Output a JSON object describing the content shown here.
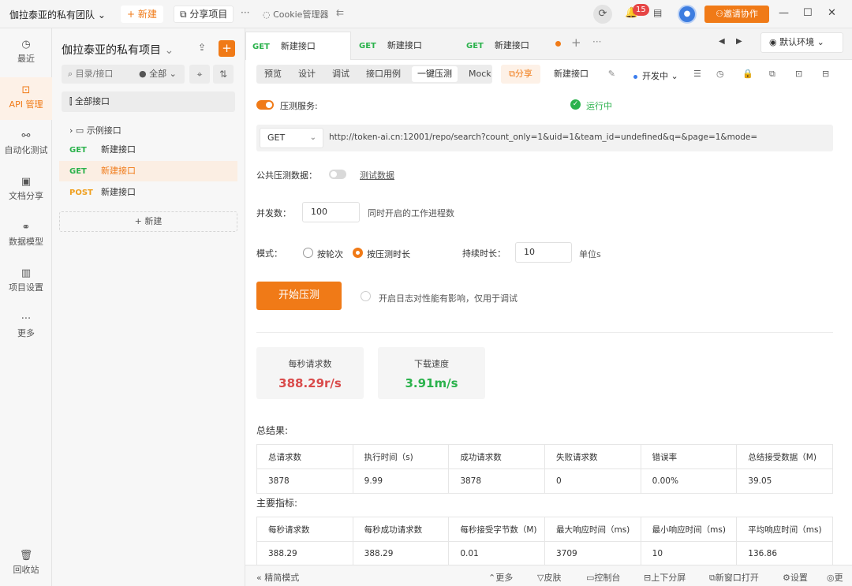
{
  "titlebar": {
    "team": "伽拉泰亚的私有团队",
    "new_label": "新建",
    "share_label": "分享项目",
    "cookie_label": "Cookie管理器",
    "notif_count": "15",
    "invite_label": "邀请协作"
  },
  "leftnav": {
    "items": [
      {
        "icon": "clock-icon",
        "label": "最近"
      },
      {
        "icon": "api-icon",
        "label": "API 管理"
      },
      {
        "icon": "automation-icon",
        "label": "自动化测试"
      },
      {
        "icon": "doc-share-icon",
        "label": "文档分享"
      },
      {
        "icon": "model-icon",
        "label": "数据模型"
      },
      {
        "icon": "settings-icon",
        "label": "项目设置"
      },
      {
        "icon": "more-icon",
        "label": "更多"
      }
    ],
    "trash_label": "回收站"
  },
  "sidebar": {
    "project_title": "伽拉泰亚的私有项目",
    "search_placeholder": "目录/接口",
    "search_filter": "全部",
    "all_apis": "全部接口",
    "folder": "示例接口",
    "apis": [
      {
        "method": "GET",
        "name": "新建接口"
      },
      {
        "method": "GET",
        "name": "新建接口"
      },
      {
        "method": "POST",
        "name": "新建接口"
      }
    ],
    "new_label": "新建"
  },
  "tabs": [
    {
      "method": "GET",
      "name": "新建接口"
    },
    {
      "method": "GET",
      "name": "新建接口"
    },
    {
      "method": "GET",
      "name": "新建接口"
    }
  ],
  "env_label": "默认环境",
  "subtabs": [
    "预览",
    "设计",
    "调试",
    "接口用例",
    "一键压测",
    "Mock"
  ],
  "share_label": "分享",
  "api_name": "新建接口",
  "status_label": "开发中",
  "stress": {
    "service_label": "压测服务:",
    "service_status": "运行中",
    "method": "GET",
    "url": "http://token-ai.cn:12001/repo/search?count_only=1&uid=1&team_id=undefined&q=&page=1&mode=",
    "public_data_label": "公共压测数据：",
    "test_data_link": "测试数据",
    "concurrency_label": "并发数：",
    "concurrency_value": "100",
    "concurrency_hint": "同时开启的工作进程数",
    "mode_label": "模式：",
    "mode_rounds": "按轮次",
    "mode_duration": "按压测时长",
    "duration_label": "持续时长：",
    "duration_value": "10",
    "duration_unit": "单位s",
    "start_label": "开始压测",
    "log_label": "开启日志对性能有影响，仅用于调试"
  },
  "stats": {
    "rps_label": "每秒请求数",
    "rps_value": "388.29r/s",
    "speed_label": "下载速度",
    "speed_value": "3.91m/s",
    "rps_color": "#d94a4a",
    "speed_color": "#2bb24c"
  },
  "summary": {
    "title": "总结果:",
    "headers": [
      "总请求数",
      "执行时间（s)",
      "成功请求数",
      "失败请求数",
      "错误率",
      "总结接受数据（M)"
    ],
    "values": [
      "3878",
      "9.99",
      "3878",
      "0",
      "0.00%",
      "39.05"
    ]
  },
  "metrics": {
    "title": "主要指标:",
    "headers": [
      "每秒请求数",
      "每秒成功请求数",
      "每秒接受字节数（M)",
      "最大响应时间（ms)",
      "最小响应时间（ms)",
      "平均响应时间（ms)"
    ],
    "values": [
      "388.29",
      "388.29",
      "0.01",
      "3709",
      "10",
      "136.86"
    ]
  },
  "bottombar": {
    "simple_mode": "精简模式",
    "more": "更多",
    "skin": "皮肤",
    "console": "控制台",
    "split": "上下分屏",
    "new_window": "新窗口打开",
    "settings": "设置",
    "update": "更"
  },
  "colors": {
    "accent": "#f07a17",
    "get": "#2bb24c",
    "post": "#f0a020"
  }
}
